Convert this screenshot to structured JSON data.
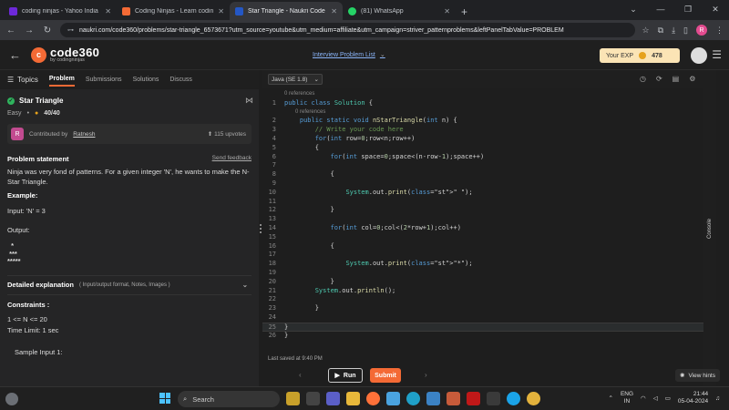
{
  "browser": {
    "tabs": [
      {
        "title": "coding ninjas - Yahoo India Se",
        "favicon_color": "#6d29d9"
      },
      {
        "title": "Coding Ninjas - Learn coding o",
        "favicon_color": "#f46a35"
      },
      {
        "title": "Star Triangle - Naukri Code 360",
        "favicon_color": "#2457c5"
      },
      {
        "title": "(81) WhatsApp",
        "favicon_color": "#25d366"
      }
    ],
    "new_tab": "+",
    "url": "naukri.com/code360/problems/star-triangle_6573671?utm_source=youtube&utm_medium=affiliate&utm_campaign=striver_patternproblems&leftPanelTabValue=PROBLEM",
    "profile_initial": "R"
  },
  "site": {
    "logo_name": "code360",
    "logo_sub": "by codingninjas",
    "problem_list": "Interview Problem List",
    "exp_label": "Your EXP",
    "exp_value": "478"
  },
  "left": {
    "topics": "Topics",
    "tabs": [
      "Problem",
      "Submissions",
      "Solutions",
      "Discuss"
    ],
    "title": "Star Triangle",
    "difficulty": "Easy",
    "score": "40/40",
    "contrib_initial": "R",
    "contrib_prefix": "Contributed by",
    "contrib_name": "Ratnesh",
    "upvotes": "115 upvotes",
    "ps_heading": "Problem statement",
    "feedback": "Send feedback",
    "statement": "Ninja was very fond of patterns. For a given integer 'N', he wants to make the N-Star Triangle.",
    "example": "Example:",
    "input": "Input: 'N' = 3",
    "output_label": "Output:",
    "output_lines": [
      "  *",
      " ***",
      "*****"
    ],
    "detail_heading": "Detailed explanation",
    "detail_sub": "( Input/output format, Notes, Images )",
    "constraints_heading": "Constraints :",
    "constraint1": "1  <= N <= 20",
    "time_limit": "Time Limit: 1 sec",
    "sample": "Sample Input 1:"
  },
  "editor": {
    "language": "Java (SE 1.8)",
    "refs": "0 references",
    "saved": "Last saved at 9:40 PM",
    "run": "Run",
    "submit": "Submit",
    "hints": "View hints",
    "console": "Console",
    "lines": [
      "public class Solution {",
      "    public static void nStarTriangle(int n) {",
      "        // Write your code here",
      "        for(int row=0;row<n;row++)",
      "        {",
      "            for(int space=0;space<(n-row-1);space++)",
      "",
      "            {",
      "",
      "                System.out.print(\" \");",
      "",
      "            }",
      "",
      "            for(int col=0;col<(2*row+1);col++)",
      "",
      "            {",
      "",
      "                System.out.print(\"*\");",
      "",
      "            }",
      "        System.out.println();",
      "",
      "        }",
      "",
      "}",
      "}"
    ]
  },
  "taskbar": {
    "search": "Search",
    "lang": "ENG",
    "region": "IN",
    "time": "21:44",
    "date": "05-04-2024"
  }
}
